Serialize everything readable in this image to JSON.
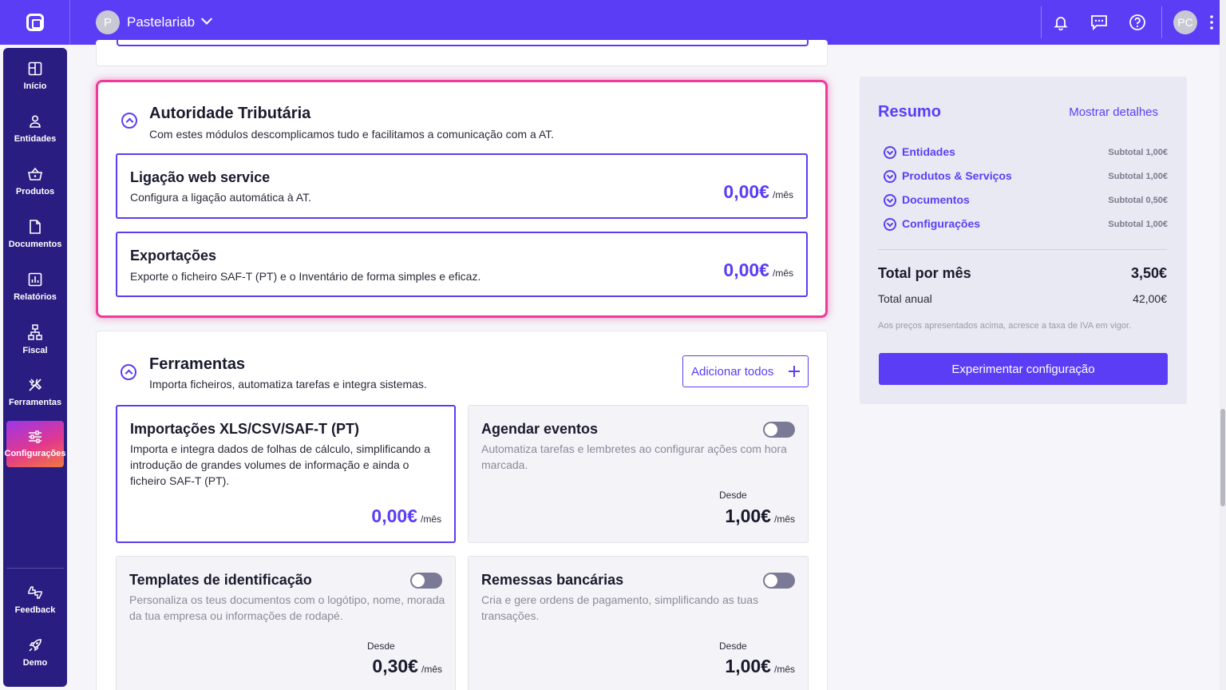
{
  "header": {
    "company_initial": "P",
    "company_name": "Pastelariab",
    "user_initials": "PC",
    "accent": "#5b3df5"
  },
  "sidebar": {
    "items": [
      {
        "label": "Início",
        "icon": "home-icon"
      },
      {
        "label": "Entidades",
        "icon": "user-icon"
      },
      {
        "label": "Produtos",
        "icon": "basket-icon"
      },
      {
        "label": "Documentos",
        "icon": "document-icon"
      },
      {
        "label": "Relatórios",
        "icon": "chart-icon"
      },
      {
        "label": "Fiscal",
        "icon": "fiscal-icon"
      },
      {
        "label": "Ferramentas",
        "icon": "tools-icon"
      },
      {
        "label": "Configurações",
        "icon": "sliders-icon",
        "active": true
      }
    ],
    "bottom": [
      {
        "label": "Feedback",
        "icon": "feedback-icon"
      },
      {
        "label": "Demo",
        "icon": "rocket-icon"
      }
    ]
  },
  "at_section": {
    "title": "Autoridade Tributária",
    "subtitle": "Com estes módulos descomplicamos tudo e facilitamos a comunicação com a AT.",
    "modules": [
      {
        "title": "Ligação web service",
        "desc": "Configura a ligação automática à AT.",
        "price": "0,00€",
        "per": "/mês"
      },
      {
        "title": "Exportações",
        "desc": "Exporte o ficheiro SAF-T (PT) e o Inventário de forma simples e eficaz.",
        "price": "0,00€",
        "per": "/mês"
      }
    ]
  },
  "tools_section": {
    "title": "Ferramentas",
    "subtitle": "Importa ficheiros, automatiza tarefas e integra sistemas.",
    "add_all": "Adicionar todos",
    "modules": [
      {
        "title": "Importações XLS/CSV/SAF-T (PT)",
        "desc": "Importa e integra dados de folhas de cálculo, simplificando a introdução de grandes volumes de informação e ainda o ficheiro SAF-T (PT).",
        "price": "0,00€",
        "per": "/mês",
        "enabled": true
      },
      {
        "title": "Agendar eventos",
        "desc": "Automatiza tarefas e lembretes ao configurar ações com hora marcada.",
        "from": "Desde",
        "price": "1,00€",
        "per": "/mês",
        "enabled": false
      },
      {
        "title": "Templates de identificação",
        "desc": "Personaliza os teus documentos com o logótipo, nome, morada da tua empresa ou informações de rodapé.",
        "from": "Desde",
        "price": "0,30€",
        "per": "/mês",
        "enabled": false
      },
      {
        "title": "Remessas bancárias",
        "desc": "Cria e gere ordens de pagamento, simplificando as tuas transações.",
        "from": "Desde",
        "price": "1,00€",
        "per": "/mês",
        "enabled": false
      }
    ]
  },
  "summary": {
    "title": "Resumo",
    "show_details": "Mostrar detalhes",
    "rows": [
      {
        "label": "Entidades",
        "subtotal": "Subtotal 1,00€"
      },
      {
        "label": "Produtos & Serviços",
        "subtotal": "Subtotal 1,00€"
      },
      {
        "label": "Documentos",
        "subtotal": "Subtotal 0,50€"
      },
      {
        "label": "Configurações",
        "subtotal": "Subtotal 1,00€"
      }
    ],
    "total_label": "Total por mês",
    "total_value": "3,50€",
    "annual_label": "Total anual",
    "annual_value": "42,00€",
    "vat_note": "Aos preços apresentados acima, acresce a taxa de IVA em vigor.",
    "try_button": "Experimentar configuração"
  }
}
